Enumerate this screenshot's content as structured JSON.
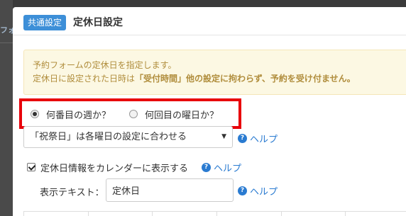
{
  "backdrop": {
    "fragment": "フォ"
  },
  "header": {
    "badge": "共通設定",
    "title": "定休日設定"
  },
  "notice": {
    "line1": "予約フォームの定休日を指定します。",
    "line2_prefix": "定休日に設定された日時は",
    "line2_strong": "「受付時間」他の設定に拘わらず、予約を受け付ません。"
  },
  "radios": [
    {
      "label": "何番目の週か？",
      "checked": true
    },
    {
      "label": "何回目の曜日か？",
      "checked": false
    }
  ],
  "holiday_select": {
    "value": "「祝祭日」は各曜日の設定に合わせる",
    "caret": "▼"
  },
  "help": {
    "label": "ヘルプ",
    "icon": "question-circle-icon",
    "glyph": "?"
  },
  "show_on_calendar": {
    "label": "定休日情報をカレンダーに表示する",
    "checked": true
  },
  "display_text": {
    "label": "表示テキスト：",
    "value": "定休日"
  },
  "colors": {
    "badge": "#3d8fd8",
    "highlight_border": "#e8000b",
    "notice_bg": "#fcf8e3",
    "notice_text": "#b08d3c",
    "link": "#2a7bd1"
  }
}
